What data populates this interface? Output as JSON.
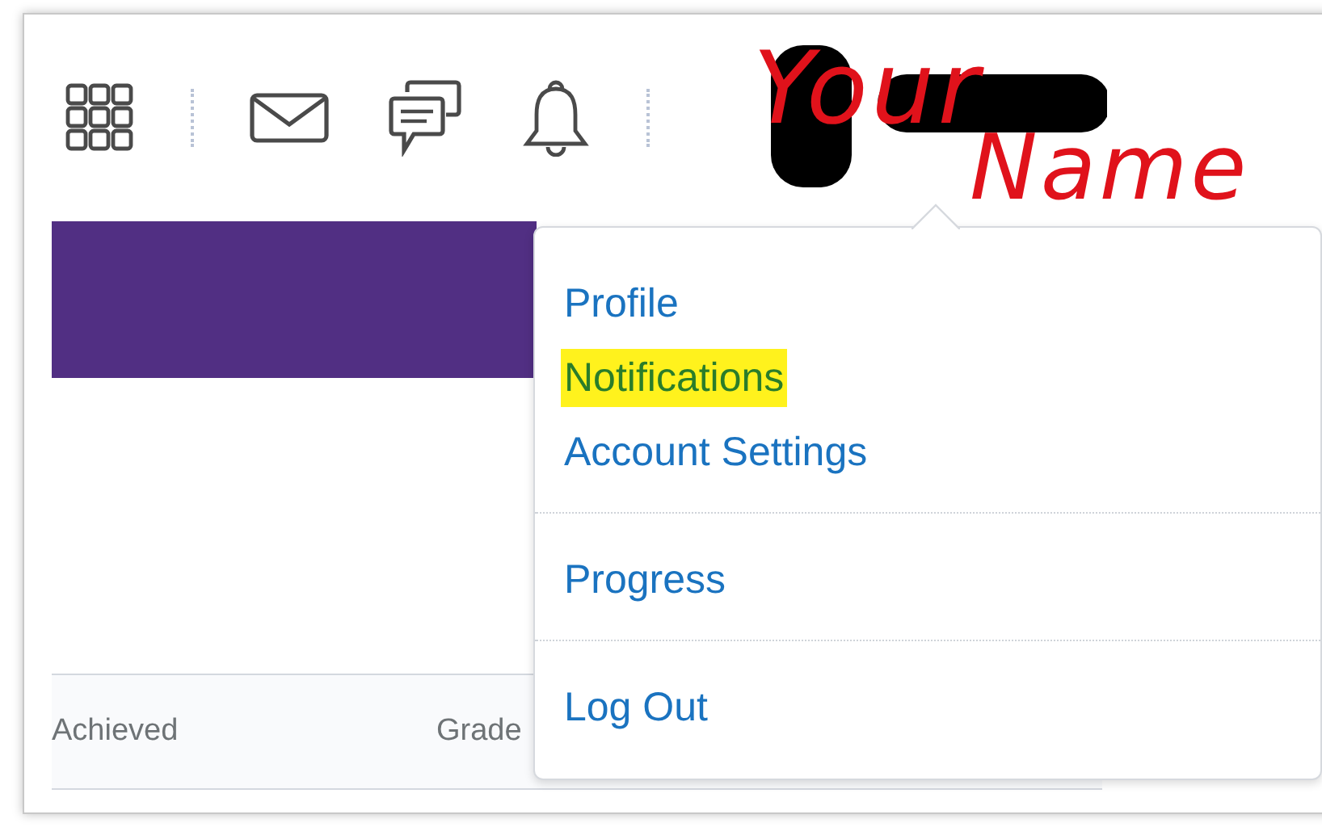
{
  "header": {
    "annotation": {
      "first_word": "Your",
      "second_word": "Name"
    }
  },
  "table": {
    "columns": [
      "Achieved",
      "Grade"
    ]
  },
  "user_menu": {
    "groups": [
      {
        "items": [
          {
            "label": "Profile",
            "highlighted": false
          },
          {
            "label": "Notifications",
            "highlighted": true
          },
          {
            "label": "Account Settings",
            "highlighted": false
          }
        ]
      },
      {
        "items": [
          {
            "label": "Progress",
            "highlighted": false
          }
        ]
      },
      {
        "items": [
          {
            "label": "Log Out",
            "highlighted": false
          }
        ]
      }
    ]
  }
}
